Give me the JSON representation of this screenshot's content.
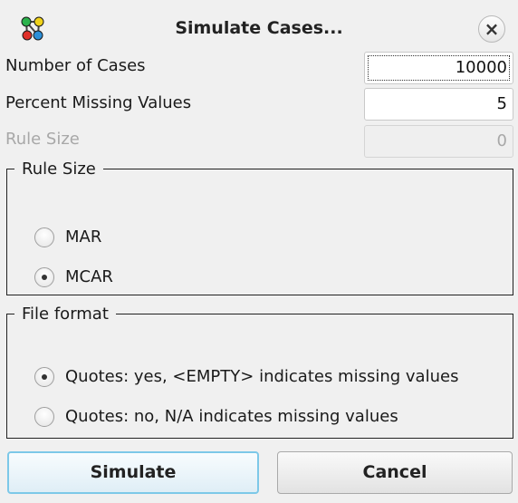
{
  "window": {
    "title": "Simulate Cases...",
    "close_glyph": "×",
    "app_icon": "network-graph-icon"
  },
  "fields": [
    {
      "label": "Number of Cases",
      "value": "10000",
      "enabled": true,
      "focused": true
    },
    {
      "label": "Percent Missing Values",
      "value": "5",
      "enabled": true,
      "focused": false
    },
    {
      "label": "Rule Size",
      "value": "0",
      "enabled": false,
      "focused": false
    }
  ],
  "rule_size_group": {
    "legend": "Rule Size",
    "options": [
      {
        "label": "MAR",
        "checked": false
      },
      {
        "label": "MCAR",
        "checked": true
      }
    ]
  },
  "file_format_group": {
    "legend": "File format",
    "options": [
      {
        "label": "Quotes: yes, <EMPTY> indicates missing values",
        "checked": true
      },
      {
        "label": "Quotes: no, N/A indicates missing values",
        "checked": false
      }
    ]
  },
  "buttons": {
    "simulate": "Simulate",
    "cancel": "Cancel"
  }
}
